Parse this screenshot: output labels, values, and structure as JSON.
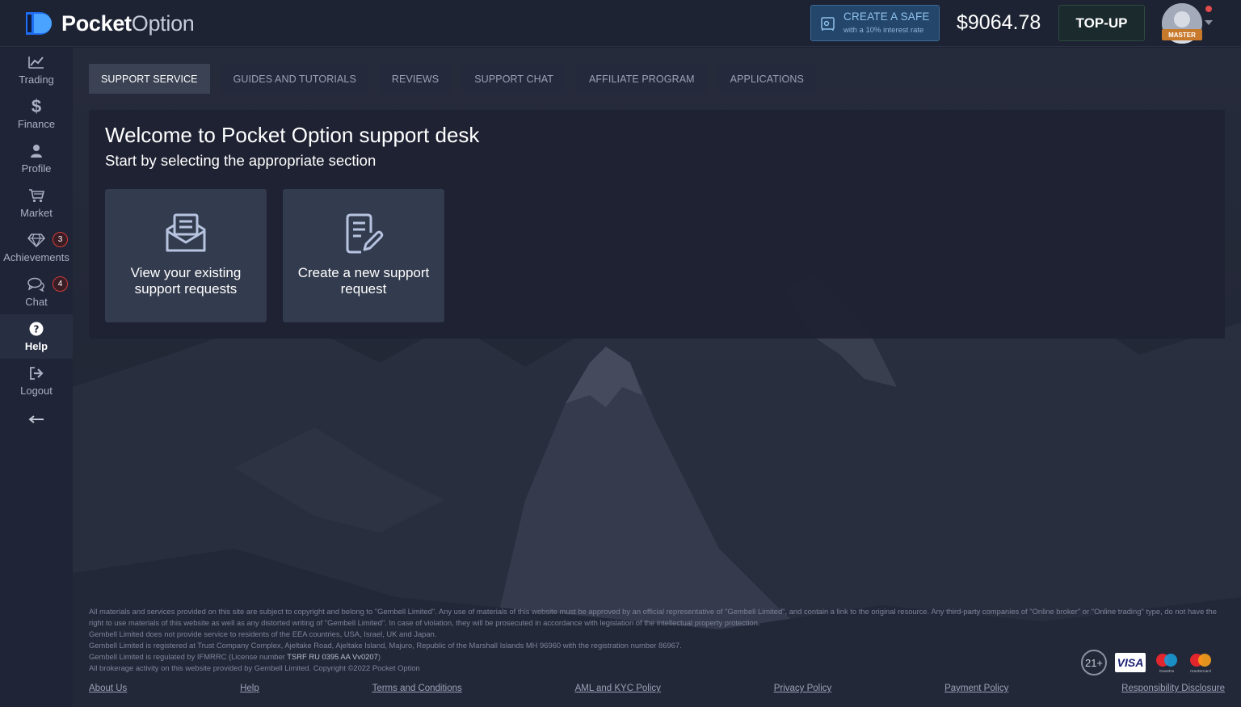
{
  "header": {
    "logo_bold": "Pocket",
    "logo_light": "Option",
    "safe_title": "CREATE A SAFE",
    "safe_sub": "with a 10% interest rate",
    "balance": "$9064.78",
    "topup_label": "TOP-UP",
    "avatar_badge": "MASTER"
  },
  "sidebar": {
    "items": [
      {
        "label": "Trading",
        "icon": "chart-line-icon"
      },
      {
        "label": "Finance",
        "icon": "dollar-icon"
      },
      {
        "label": "Profile",
        "icon": "user-icon"
      },
      {
        "label": "Market",
        "icon": "cart-icon"
      },
      {
        "label": "Achievements",
        "icon": "diamond-icon",
        "badge": "3"
      },
      {
        "label": "Chat",
        "icon": "chat-icon",
        "badge": "4"
      },
      {
        "label": "Help",
        "icon": "help-icon",
        "active": true
      },
      {
        "label": "Logout",
        "icon": "logout-icon"
      }
    ]
  },
  "tabs": [
    {
      "label": "SUPPORT SERVICE",
      "active": true
    },
    {
      "label": "GUIDES AND TUTORIALS"
    },
    {
      "label": "REVIEWS"
    },
    {
      "label": "SUPPORT CHAT"
    },
    {
      "label": "AFFILIATE PROGRAM"
    },
    {
      "label": "APPLICATIONS"
    }
  ],
  "main": {
    "title": "Welcome to Pocket Option support desk",
    "subtitle": "Start by selecting the appropriate section",
    "cards": [
      {
        "label": "View your existing support requests",
        "icon": "envelope-open-icon"
      },
      {
        "label": "Create a new support request",
        "icon": "document-edit-icon"
      }
    ]
  },
  "footer": {
    "legal_1": "All materials and services provided on this site are subject to copyright and belong to \"Gembell Limited\". Any use of materials of this website must be approved by an official representative of \"Gembell Limited\", and contain a link to the original resource. Any third-party companies of \"Online broker\" or \"Online trading\" type, do not have the right to use materials of this website as well as any distorted writing of \"Gembell Limited\". In case of violation, they will be prosecuted in accordance with legislation of the intellectual property protection.",
    "legal_2": "Gembell Limited does not provide service to residents of the EEA countries, USA, Israel, UK and Japan.",
    "legal_3": "Gembell Limited is registered at Trust Company Complex, Ajeltake Road, Ajeltake Island, Majuro, Republic of the Marshall Islands MH 96960 with the registration number 86967.",
    "legal_4_prefix": "Gembell Limited is regulated by IFMRRC (License number ",
    "legal_4_license": "TSRF RU 0395 AA Vv0207",
    "legal_4_suffix": ")",
    "legal_5": "All brokerage activity on this website provided by Gembell Limited. Copyright ©2022 Pocket Option",
    "age_badge": "21+",
    "visa": "VISA",
    "maestro": "maestro",
    "mastercard": "mastercard",
    "links": [
      "About Us",
      "Help",
      "Terms and Conditions",
      "AML and KYC Policy",
      "Privacy Policy",
      "Payment Policy",
      "Responsibility Disclosure"
    ]
  },
  "colors": {
    "background": "#1c2131",
    "accent_blue": "#24466a",
    "badge_red": "#d23b3b",
    "master_badge": "#c87a2c"
  }
}
